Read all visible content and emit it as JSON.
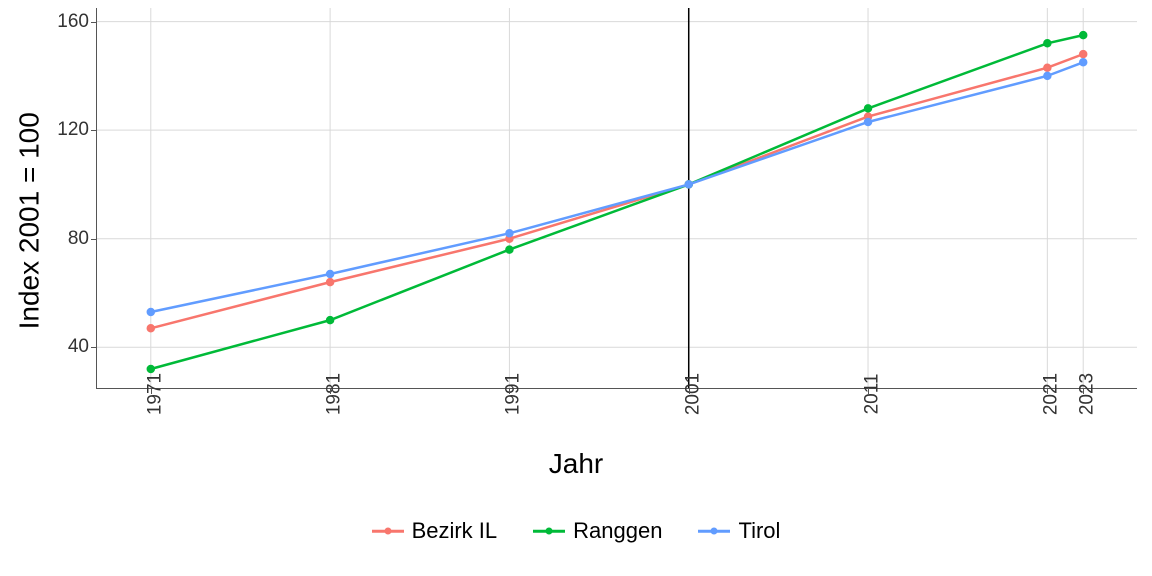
{
  "chart_data": {
    "type": "line",
    "xlabel": "Jahr",
    "ylabel": "Index 2001 = 100",
    "x": [
      1971,
      1981,
      1991,
      2001,
      2011,
      2021,
      2023
    ],
    "x_ticks": [
      1971,
      1981,
      1991,
      2001,
      2011,
      2021,
      2023
    ],
    "y_ticks": [
      40,
      80,
      120,
      160
    ],
    "xlim": [
      1968,
      2026
    ],
    "ylim": [
      25,
      165
    ],
    "reference_x": 2001,
    "series": [
      {
        "name": "Bezirk IL",
        "color": "#f8766d",
        "values": [
          47,
          64,
          80,
          100,
          125,
          143,
          148
        ]
      },
      {
        "name": "Ranggen",
        "color": "#00ba38",
        "values": [
          32,
          50,
          76,
          100,
          128,
          152,
          155
        ]
      },
      {
        "name": "Tirol",
        "color": "#619cff",
        "values": [
          53,
          67,
          82,
          100,
          123,
          140,
          145
        ]
      }
    ],
    "legend_order": [
      "Bezirk IL",
      "Ranggen",
      "Tirol"
    ]
  }
}
